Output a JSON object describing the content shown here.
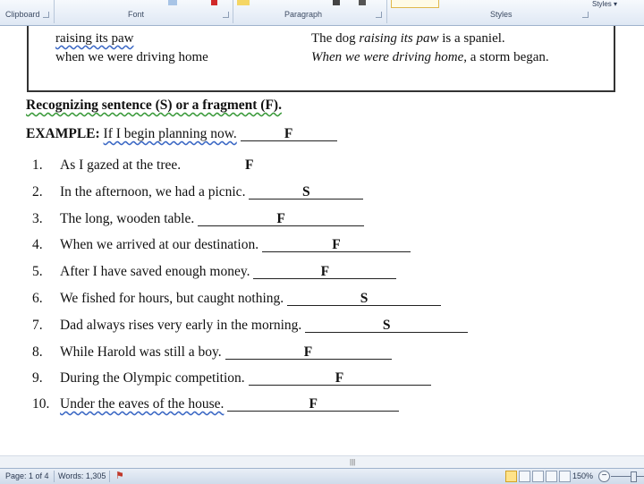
{
  "ribbon": {
    "groups": [
      "Clipboard",
      "Font",
      "Paragraph",
      "Styles"
    ],
    "styles_label": "Styles ▾"
  },
  "examples_box": {
    "rows": [
      {
        "left": "raising its paw",
        "right_pre": "The dog ",
        "right_italic": "raising its paw",
        "right_post": " is a spaniel."
      },
      {
        "left": "when we were driving home",
        "right_pre": "",
        "right_italic": "When we were driving home",
        "right_post": ", a storm began."
      }
    ]
  },
  "heading": "Recognizing sentence (S) or a fragment (F).",
  "example": {
    "label": "EXAMPLE:",
    "text": "If I begin planning now.",
    "answer": "F"
  },
  "items": [
    {
      "num": "1.",
      "text": "As I gazed at the tree.",
      "answer": "F"
    },
    {
      "num": "2.",
      "text": "In the afternoon, we had a picnic.",
      "answer": "S"
    },
    {
      "num": "3.",
      "text": "The long, wooden table.",
      "answer": "F"
    },
    {
      "num": "4.",
      "text": "When we arrived at our destination.",
      "answer": "F"
    },
    {
      "num": "5.",
      "text": "After I have saved enough money.",
      "answer": "F"
    },
    {
      "num": "6.",
      "text": "We fished for hours, but caught nothing.",
      "answer": "S"
    },
    {
      "num": "7.",
      "text": "Dad always rises very early in the morning.",
      "answer": "S"
    },
    {
      "num": "8.",
      "text": "While Harold was still a boy.",
      "answer": "F"
    },
    {
      "num": "9.",
      "text": "During the Olympic competition.",
      "answer": "F"
    },
    {
      "num": "10.",
      "text": "Under the eaves of the house.",
      "answer": "F"
    }
  ],
  "status": {
    "page": "Page: 1 of 4",
    "words": "Words: 1,305",
    "zoom": "150%"
  },
  "colors": {
    "ribbon_bg": "#dfe8f4",
    "status_bg": "#cfdbea",
    "spell_underline": "#3a67c4"
  }
}
